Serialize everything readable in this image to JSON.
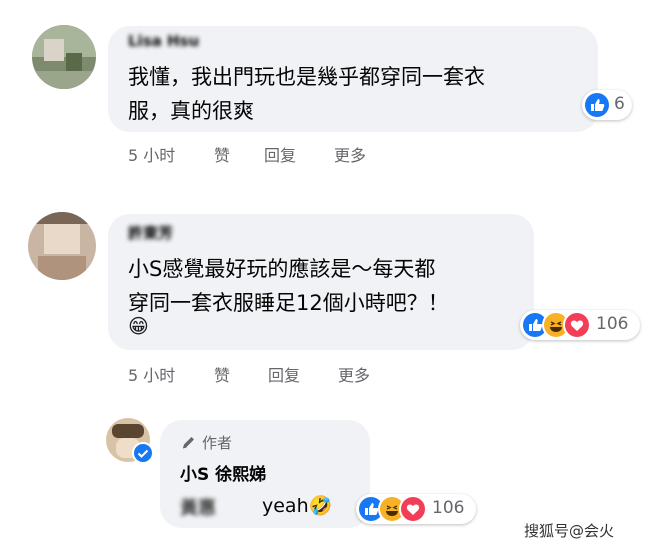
{
  "comments": [
    {
      "author": "Lisa Hsu",
      "text": "我懂，我出門玩也是幾乎都穿同一套衣\n服，真的很爽",
      "reaction_count": "6",
      "time": "5 小时",
      "like_label": "赞",
      "reply_label": "回复",
      "more_label": "更多"
    },
    {
      "author": "許東芳",
      "text": "小S感覺最好玩的應該是～每天都\n穿同一套衣服睡足12個小時吧？！",
      "emoji": "😁",
      "reaction_count": "106",
      "time": "5 小时",
      "like_label": "赞",
      "reply_label": "回复",
      "more_label": "更多"
    }
  ],
  "reply": {
    "badge": "作者",
    "author": "小S 徐熙娣",
    "tag": "黃惠",
    "text": "yeah🤣",
    "reaction_count": "106"
  },
  "watermark": "搜狐号@会火",
  "colors": {
    "like": "#1877f2",
    "haha": "#f7b125",
    "love": "#f33e58",
    "verified": "#1877f2",
    "bubble": "#f0f2f5"
  },
  "icons": [
    "like-icon",
    "haha-icon",
    "love-icon",
    "pencil-icon",
    "verified-icon"
  ]
}
